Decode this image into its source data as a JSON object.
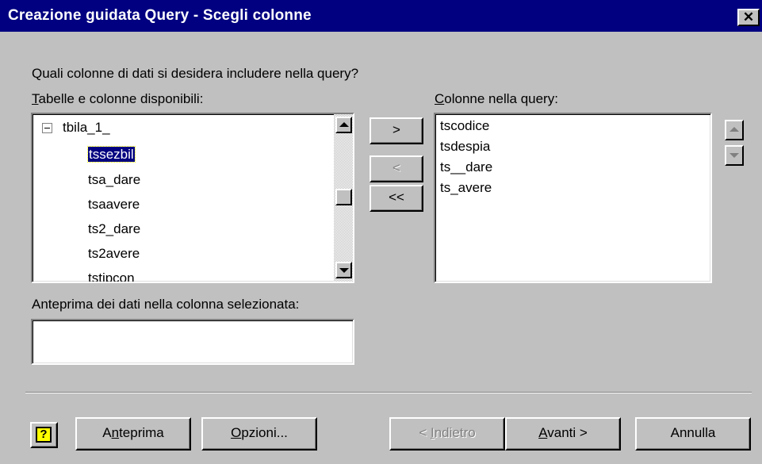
{
  "window": {
    "title": "Creazione guidata Query - Scegli colonne",
    "close_glyph": "✕"
  },
  "prompt": "Quali colonne di dati si desidera includere nella query?",
  "available": {
    "label_underlined": "T",
    "label_rest": "abelle e colonne disponibili:",
    "table_name": "tbila_1_",
    "columns": [
      "tssezbil",
      "tsa_dare",
      "tsaavere",
      "ts2_dare",
      "ts2avere",
      "tstipcon"
    ],
    "selected_index": 0
  },
  "transfer_buttons": {
    "add": ">",
    "remove": "<",
    "remove_all": "<<"
  },
  "query_columns": {
    "label_underlined": "C",
    "label_rest": "olonne nella query:",
    "items": [
      "tscodice",
      "tsdespia",
      "ts__dare",
      "ts_avere"
    ]
  },
  "preview": {
    "label": "Anteprima dei dati nella colonna selezionata:",
    "value": ""
  },
  "footer": {
    "help_glyph": "?",
    "preview_btn": {
      "pre": "A",
      "u": "n",
      "post": "teprima"
    },
    "options_btn": {
      "pre": "",
      "u": "O",
      "post": "pzioni..."
    },
    "back_btn": {
      "pre": "< ",
      "u": "I",
      "post": "ndietro"
    },
    "next_btn": {
      "pre": "",
      "u": "A",
      "post": "vanti >"
    },
    "cancel_btn": {
      "pre": "Annulla",
      "u": "",
      "post": ""
    }
  },
  "icons": {
    "tree_toggle": "minus-box-icon",
    "help": "help-icon",
    "scroll_up": "arrow-up-icon",
    "scroll_down": "arrow-down-icon",
    "move_up": "arrow-up-icon",
    "move_down": "arrow-down-icon"
  },
  "colors": {
    "titlebar": "#000080",
    "face": "#c0c0c0",
    "selection": "#000080"
  }
}
